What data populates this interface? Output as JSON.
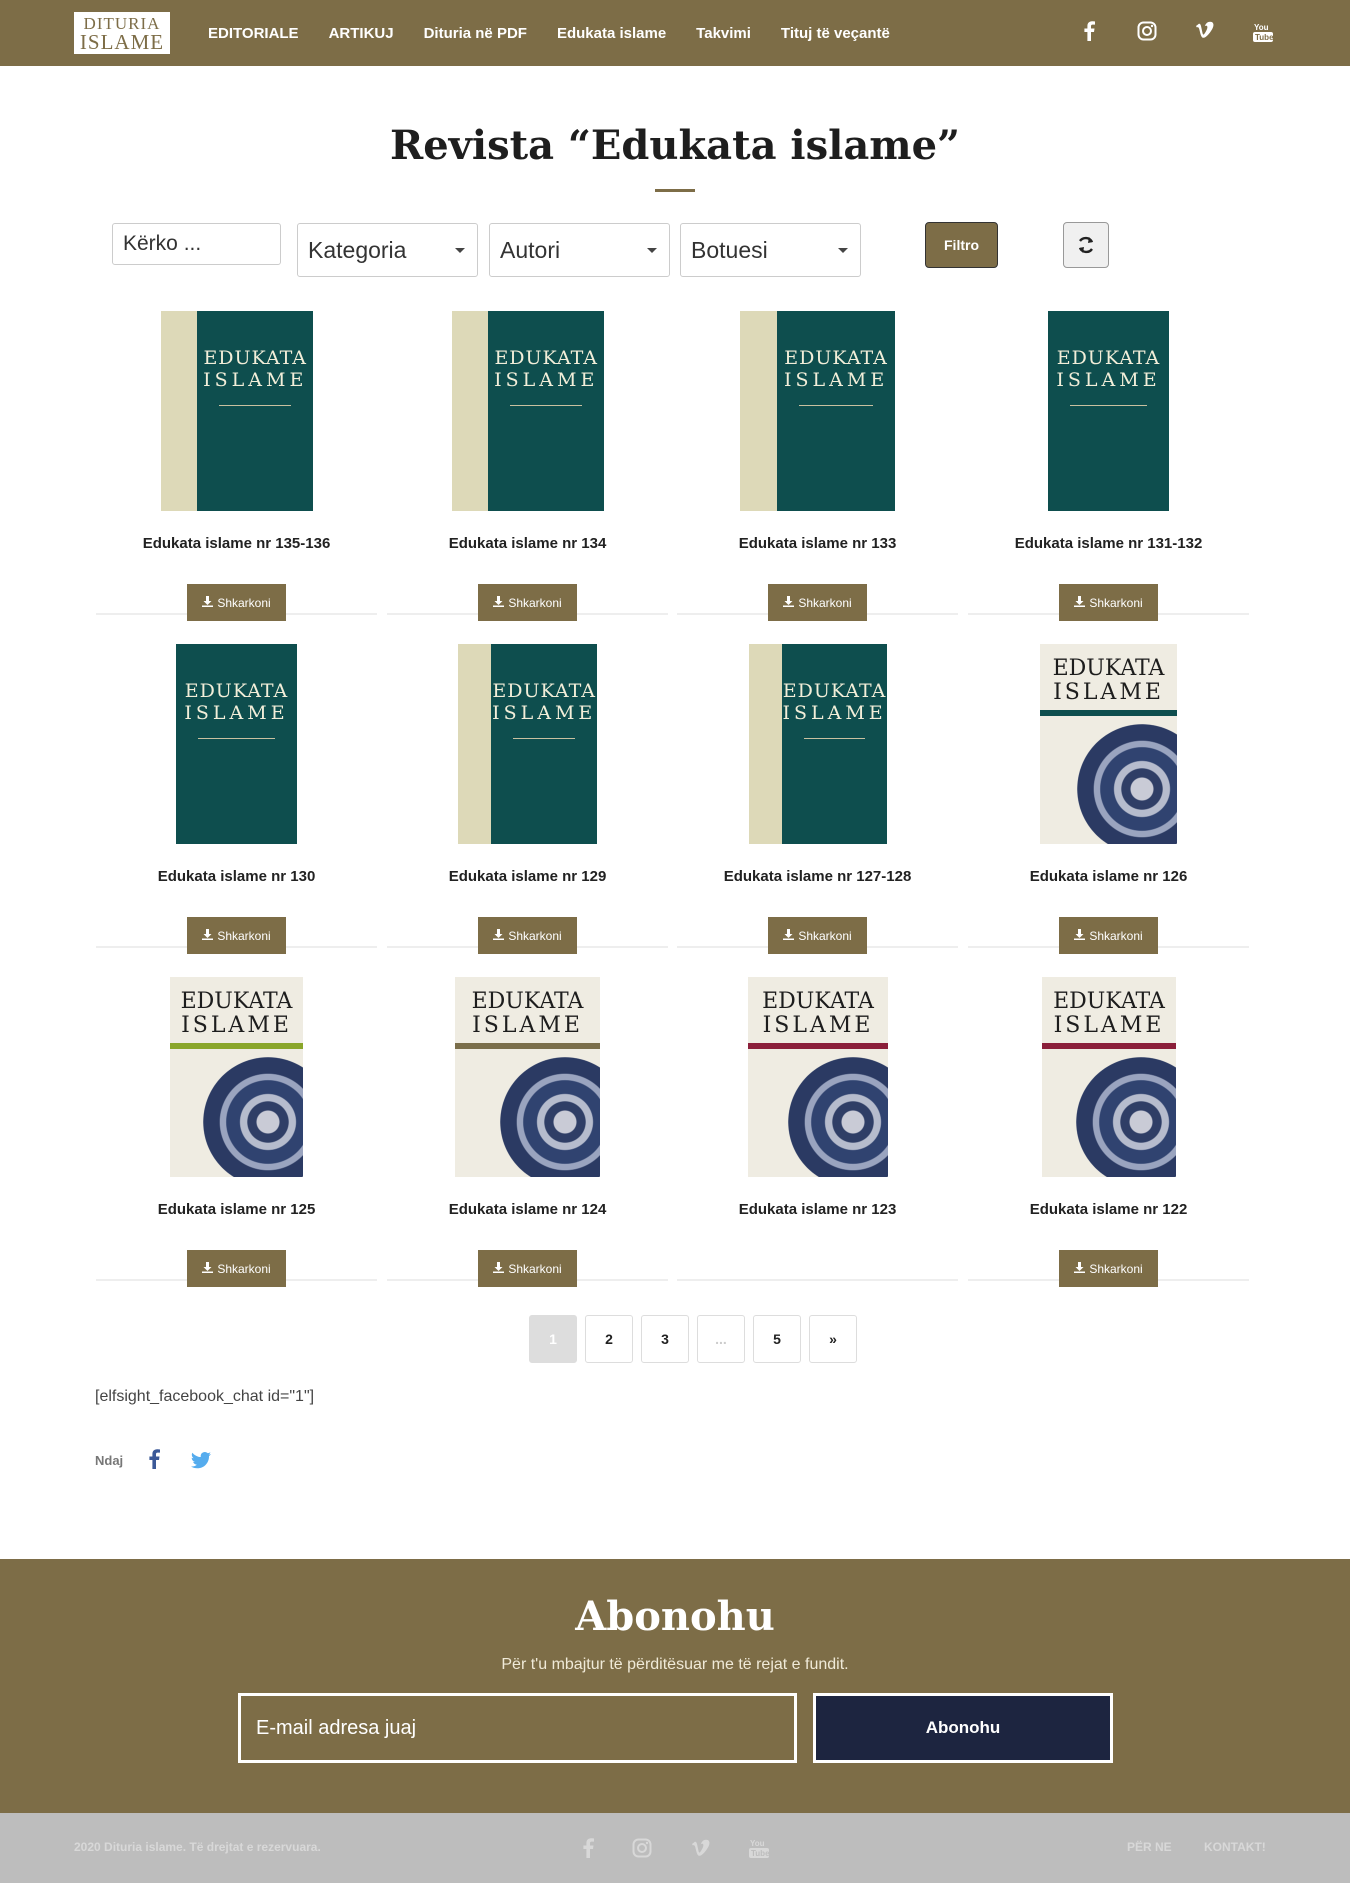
{
  "logo": {
    "line1": "DITURIA",
    "line2": "ISLAME"
  },
  "nav": {
    "items": [
      "EDITORIALE",
      "ARTIKUJ",
      "Dituria në PDF",
      "Edukata islame",
      "Takvimi",
      "Tituj të veçantë"
    ]
  },
  "social_icons": [
    "facebook-icon",
    "instagram-icon",
    "vimeo-icon",
    "youtube-icon"
  ],
  "page": {
    "title": "Revista “Edukata islame”"
  },
  "filters": {
    "search_placeholder": "Kërko ...",
    "category": "Kategoria",
    "author": "Autori",
    "publisher": "Botuesi",
    "filter_button": "Filtro",
    "refresh_icon": "refresh-icon"
  },
  "items": [
    {
      "title": "Edukata islame nr 135-136",
      "download": "Shkarkoni",
      "cover": "teal"
    },
    {
      "title": "Edukata islame nr 134",
      "download": "Shkarkoni",
      "cover": "teal"
    },
    {
      "title": "Edukata islame nr 133",
      "download": "Shkarkoni",
      "cover": "teal"
    },
    {
      "title": "Edukata islame nr 131-132",
      "download": "Shkarkoni",
      "cover": "teal"
    },
    {
      "title": "Edukata islame nr 130",
      "download": "Shkarkoni",
      "cover": "teal"
    },
    {
      "title": "Edukata islame nr 129",
      "download": "Shkarkoni",
      "cover": "teal"
    },
    {
      "title": "Edukata islame nr 127-128",
      "download": "Shkarkoni",
      "cover": "teal"
    },
    {
      "title": "Edukata islame nr 126",
      "download": "Shkarkoni",
      "cover": "cream"
    },
    {
      "title": "Edukata islame nr 125",
      "download": "Shkarkoni",
      "cover": "cream"
    },
    {
      "title": "Edukata islame nr 124",
      "download": "Shkarkoni",
      "cover": "cream"
    },
    {
      "title": "Edukata islame nr 123",
      "download": "",
      "cover": "cream"
    },
    {
      "title": "Edukata islame nr 122",
      "download": "Shkarkoni",
      "cover": "cream"
    }
  ],
  "cover_text": {
    "line1": "EDUKATA",
    "line2": "ISLAME"
  },
  "pagination": [
    "1",
    "2",
    "3",
    "...",
    "5",
    "»"
  ],
  "pagination_active": "1",
  "shortcode": "[elfsight_facebook_chat id=\"1\"]",
  "share": {
    "label": "Ndaj"
  },
  "subscribe": {
    "title": "Abonohu",
    "text": "Për t'u mbajtur të përditësuar me të rejat e fundit.",
    "email_placeholder": "E-mail adresa juaj",
    "button": "Abonohu"
  },
  "footer": {
    "copyright": "2020 Dituria islame. Të drejtat e rezervuara.",
    "links": [
      "PËR NE",
      "KONTAKT!"
    ]
  },
  "colors": {
    "brand": "#7d6d47",
    "subscribe_button": "#1d2540",
    "teal_cover": "#0e4e4e",
    "cream_cover": "#efece2",
    "footer": "#bdbdbd"
  }
}
